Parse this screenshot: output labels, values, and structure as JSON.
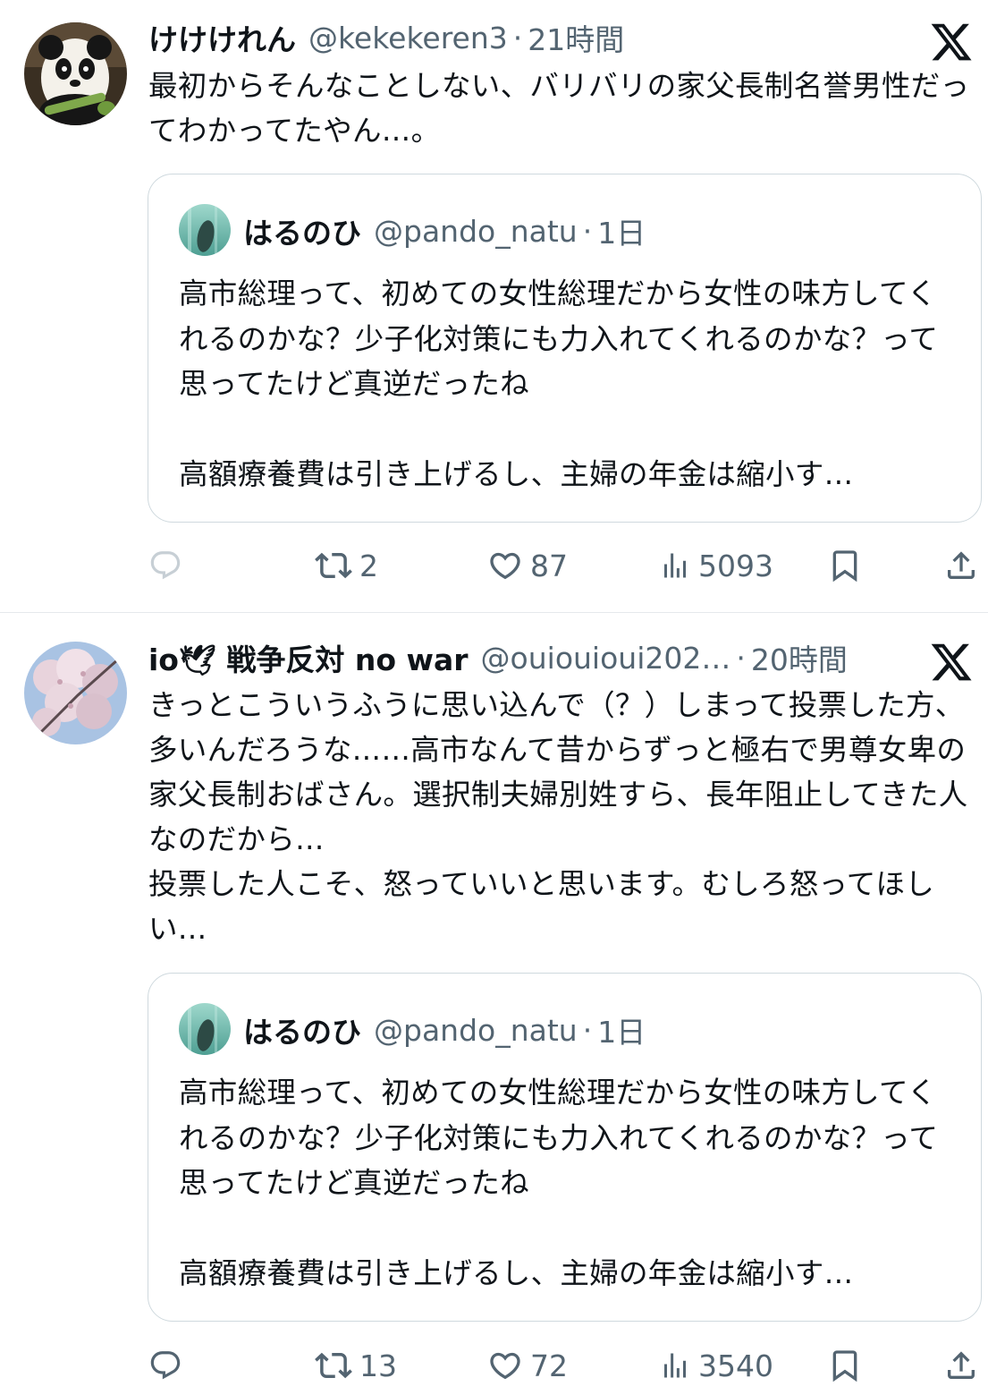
{
  "tweets": [
    {
      "display_name": "けけけれん",
      "handle": "@kekekeren3",
      "separator": "·",
      "time": "21時間",
      "text": "最初からそんなことしない、バリバリの家父長制名誉男性だってわかってたやん…。",
      "avatar_icon": "panda-avatar",
      "quote": {
        "display_name": "はるのひ",
        "handle": "@pando_natu",
        "separator": "·",
        "time": "1日",
        "text": "高市総理って、初めての女性総理だから女性の味方してくれるのかな？少子化対策にも力入れてくれるのかな？って思ってたけど真逆だったね\n\n高額療養費は引き上げるし、主婦の年金は縮小す…"
      },
      "actions": {
        "reply": "",
        "retweet": "2",
        "like": "87",
        "views": "5093"
      }
    },
    {
      "display_name": "io🕊 戦争反対 no war",
      "handle": "@ouiouioui202…",
      "separator": "·",
      "time": "20時間",
      "text": "きっとこういうふうに思い込んで（？）しまって投票した方、多いんだろうな……高市なんて昔からずっと極右で男尊女卑の家父長制おばさん。選択制夫婦別姓すら、長年阻止してきた人なのだから…\n投票した人こそ、怒っていいと思います。むしろ怒ってほしい…",
      "avatar_icon": "cherry-blossom-avatar",
      "quote": {
        "display_name": "はるのひ",
        "handle": "@pando_natu",
        "separator": "·",
        "time": "1日",
        "text": "高市総理って、初めての女性総理だから女性の味方してくれるのかな？少子化対策にも力入れてくれるのかな？って思ってたけど真逆だったね\n\n高額療養費は引き上げるし、主婦の年金は縮小す…"
      },
      "actions": {
        "reply": "",
        "retweet": "13",
        "like": "72",
        "views": "3540"
      }
    }
  ],
  "colors": {
    "text": "#0f1419",
    "muted": "#536471",
    "border": "#cfd9de",
    "divider": "#e6e9ec"
  },
  "icons": {
    "logo": "x-logo-icon",
    "reply": "reply-icon",
    "retweet": "retweet-icon",
    "like": "heart-icon",
    "views": "views-chart-icon",
    "bookmark": "bookmark-icon",
    "share": "share-icon"
  }
}
